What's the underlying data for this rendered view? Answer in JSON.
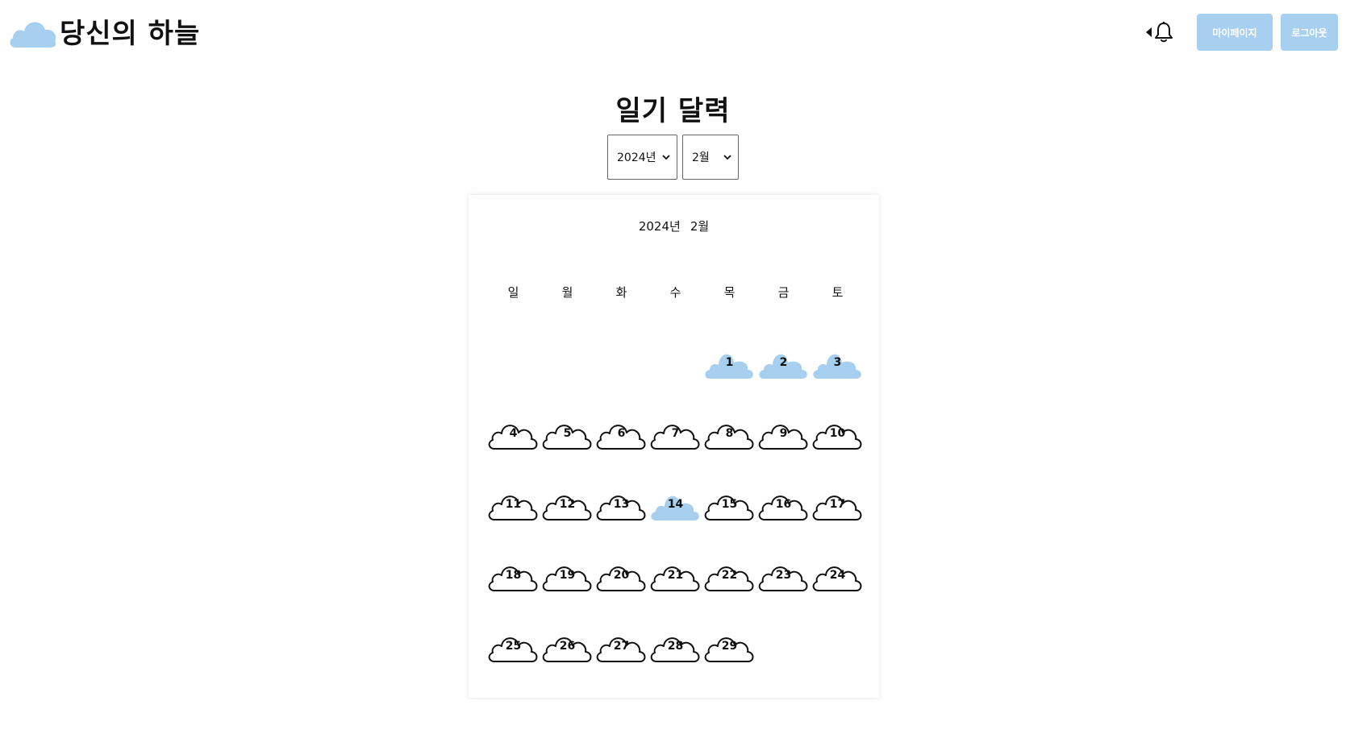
{
  "header": {
    "logo_text": "당신의 하늘",
    "mypage_label": "마이페이지",
    "logout_label": "로그아웃",
    "icons": [
      "cloud-logo-icon",
      "caret-left-icon",
      "bell-icon"
    ]
  },
  "page": {
    "title": "일기 달력"
  },
  "selects": {
    "year": "2024년",
    "month": "2월"
  },
  "calendar": {
    "caption_year": "2024년",
    "caption_month": "2월",
    "weekdays": [
      "일",
      "월",
      "화",
      "수",
      "목",
      "금",
      "토"
    ],
    "weeks": [
      [
        null,
        null,
        null,
        null,
        {
          "day": "1",
          "filled": true
        },
        {
          "day": "2",
          "filled": true
        },
        {
          "day": "3",
          "filled": true
        }
      ],
      [
        {
          "day": "4"
        },
        {
          "day": "5"
        },
        {
          "day": "6"
        },
        {
          "day": "7"
        },
        {
          "day": "8"
        },
        {
          "day": "9"
        },
        {
          "day": "10"
        }
      ],
      [
        {
          "day": "11"
        },
        {
          "day": "12"
        },
        {
          "day": "13"
        },
        {
          "day": "14",
          "filled": true
        },
        {
          "day": "15"
        },
        {
          "day": "16"
        },
        {
          "day": "17"
        }
      ],
      [
        {
          "day": "18"
        },
        {
          "day": "19"
        },
        {
          "day": "20"
        },
        {
          "day": "21"
        },
        {
          "day": "22"
        },
        {
          "day": "23"
        },
        {
          "day": "24"
        }
      ],
      [
        {
          "day": "25"
        },
        {
          "day": "26"
        },
        {
          "day": "27"
        },
        {
          "day": "28"
        },
        {
          "day": "29"
        },
        null,
        null
      ]
    ]
  },
  "colors": {
    "accent": "#a7cff0",
    "cloud_fill": "#a7cff0",
    "cloud_outline": "#111111"
  }
}
